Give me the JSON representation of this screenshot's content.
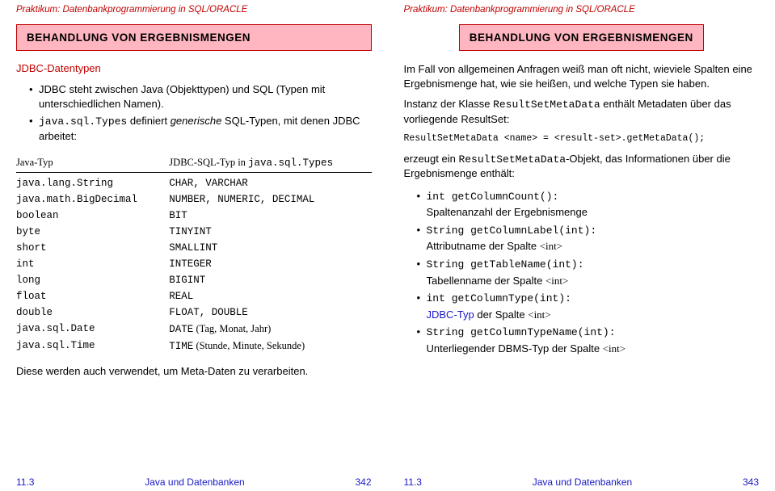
{
  "header": "Praktikum: Datenbankprogrammierung in SQL/ORACLE",
  "left": {
    "title": "BEHANDLUNG VON ERGEBNISMENGEN",
    "subhead": "JDBC-Datentypen",
    "bullet1": "JDBC steht zwischen Java (Objekttypen) und SQL (Typen mit unterschiedlichen Namen).",
    "bullet2_code": "java.sql.Types",
    "bullet2_rest": " definiert ",
    "bullet2_emph": "generische",
    "bullet2_tail": " SQL-Typen, mit denen JDBC arbeitet:",
    "table_head_left": "Java-Typ",
    "table_head_right": "JDBC-SQL-Typ in ",
    "table_head_right_code": "java.sql.Types",
    "rows": [
      {
        "l": "java.lang.String",
        "r": "CHAR, VARCHAR"
      },
      {
        "l": "java.math.BigDecimal",
        "r": "NUMBER, NUMERIC, DECIMAL"
      },
      {
        "l": "boolean",
        "r": "BIT"
      },
      {
        "l": "byte",
        "r": "TINYINT"
      },
      {
        "l": "short",
        "r": "SMALLINT"
      },
      {
        "l": "int",
        "r": "INTEGER"
      },
      {
        "l": "long",
        "r": "BIGINT"
      },
      {
        "l": "float",
        "r": "REAL"
      },
      {
        "l": "double",
        "r": "FLOAT, DOUBLE"
      }
    ],
    "row_date_l": "java.sql.Date",
    "row_date_r_code": "DATE",
    "row_date_r_serif": " (Tag, Monat, Jahr)",
    "row_time_l": "java.sql.Time",
    "row_time_r_code": "TIME",
    "row_time_r_serif": " (Stunde, Minute, Sekunde)",
    "closing": "Diese werden auch verwendet, um Meta-Daten zu verarbeiten.",
    "footer_left": "11.3",
    "footer_center": "Java und Datenbanken",
    "footer_right": "342"
  },
  "right": {
    "title": "BEHANDLUNG VON ERGEBNISMENGEN",
    "p1": "Im Fall von allgemeinen Anfragen weiß man oft nicht, wieviele Spalten eine Ergebnismenge hat, wie sie heißen, und welche Typen sie haben.",
    "p2a": "Instanz der Klasse ",
    "p2code": "ResultSetMetaData",
    "p2b": " enthält Metadaten über das vorliegende ResultSet:",
    "codeLine": "ResultSetMetaData <name> = <result-set>.getMetaData();",
    "p3a": "erzeugt ein ",
    "p3code": "ResultSetMetaData",
    "p3b": "-Objekt, das Informationen über die Ergebnismenge enthält:",
    "items": [
      {
        "code": "int getColumnCount():",
        "desc": "Spaltenanzahl der Ergebnismenge",
        "blue_int": false
      },
      {
        "code": "String getColumnLabel(int):",
        "desc_prefix": "Attributname der Spalte ",
        "desc_int": "<int>",
        "blue_int": false
      },
      {
        "code": "String getTableName(int):",
        "desc_prefix": "Tabellenname der Spalte ",
        "desc_int": "<int>",
        "blue_int": false
      },
      {
        "code": "int getColumnType(int):",
        "desc_prefix_blue": "JDBC-Typ",
        "desc_rest": " der Spalte ",
        "desc_int": "<int>",
        "blue_int": false
      },
      {
        "code": "String getColumnTypeName(int):",
        "desc_prefix": "Unterliegender DBMS-Typ der Spalte ",
        "desc_int": "<int>",
        "blue_int": false
      }
    ],
    "footer_left": "11.3",
    "footer_center": "Java und Datenbanken",
    "footer_right": "343"
  }
}
